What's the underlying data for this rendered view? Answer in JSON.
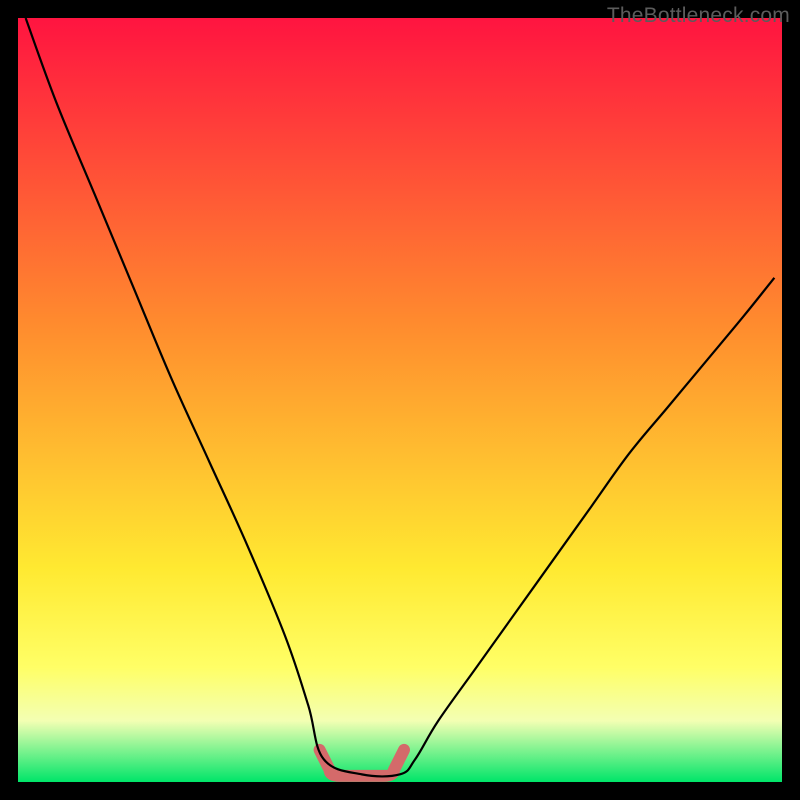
{
  "watermark": "TheBottleneck.com",
  "colors": {
    "frame": "#000000",
    "curve": "#000000",
    "baseline_shape": "#d46a6a",
    "gradient_top": "#ff1440",
    "gradient_mid1": "#ff8b2e",
    "gradient_mid2": "#ffe931",
    "gradient_bottom_yellow": "#ffff66",
    "gradient_pale": "#f3ffb3",
    "gradient_green": "#00e569"
  },
  "chart_data": {
    "type": "line",
    "title": "",
    "xlabel": "",
    "ylabel": "",
    "xlim": [
      0,
      100
    ],
    "ylim": [
      0,
      100
    ],
    "note": "V-shaped bottleneck curve. Values are read off the image as percentages of the plot width (x) and height (y, 0 = bottom, 100 = top). Curve touches zero (optimal, no bottleneck) roughly between x=40 and x=50.",
    "series": [
      {
        "name": "bottleneck-curve",
        "x": [
          1,
          5,
          10,
          15,
          20,
          25,
          30,
          35,
          38,
          40,
          45,
          50,
          52,
          55,
          60,
          65,
          70,
          75,
          80,
          85,
          90,
          95,
          99
        ],
        "y": [
          100,
          89,
          77,
          65,
          53,
          42,
          31,
          19,
          10,
          3,
          1,
          1,
          3,
          8,
          15,
          22,
          29,
          36,
          43,
          49,
          55,
          61,
          66
        ]
      }
    ],
    "flat_zone": {
      "x_start": 40,
      "x_end": 50,
      "y": 0.8
    },
    "gradient_stops": [
      {
        "offset": 0.0,
        "color": "#ff1440"
      },
      {
        "offset": 0.4,
        "color": "#ff8b2e"
      },
      {
        "offset": 0.72,
        "color": "#ffe931"
      },
      {
        "offset": 0.85,
        "color": "#ffff66"
      },
      {
        "offset": 0.92,
        "color": "#f3ffb3"
      },
      {
        "offset": 1.0,
        "color": "#00e569"
      }
    ]
  }
}
